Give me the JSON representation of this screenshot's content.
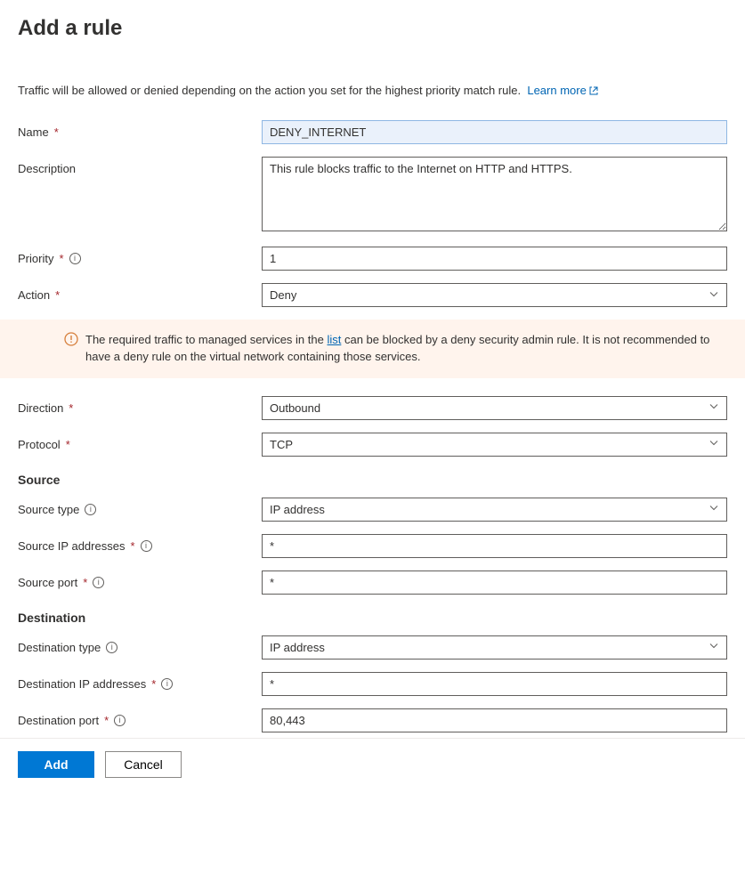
{
  "page_title": "Add a rule",
  "intro_text": "Traffic will be allowed or denied depending on the action you set for the highest priority match rule.",
  "learn_more_label": "Learn more",
  "labels": {
    "name": "Name",
    "description": "Description",
    "priority": "Priority",
    "action": "Action",
    "direction": "Direction",
    "protocol": "Protocol",
    "source_section": "Source",
    "source_type": "Source type",
    "source_ip": "Source IP addresses",
    "source_port": "Source port",
    "destination_section": "Destination",
    "destination_type": "Destination type",
    "destination_ip": "Destination IP addresses",
    "destination_port": "Destination port"
  },
  "values": {
    "name": "DENY_INTERNET",
    "description": "This rule blocks traffic to the Internet on HTTP and HTTPS.",
    "priority": "1",
    "action": "Deny",
    "direction": "Outbound",
    "protocol": "TCP",
    "source_type": "IP address",
    "source_ip": "*",
    "source_port": "*",
    "destination_type": "IP address",
    "destination_ip": "*",
    "destination_port": "80,443"
  },
  "warning": {
    "prefix": "The required traffic to managed services in the ",
    "link_text": "list",
    "suffix": " can be blocked by a deny security admin rule. It is not recommended to have a deny rule on the virtual network containing those services."
  },
  "footer": {
    "add": "Add",
    "cancel": "Cancel"
  }
}
